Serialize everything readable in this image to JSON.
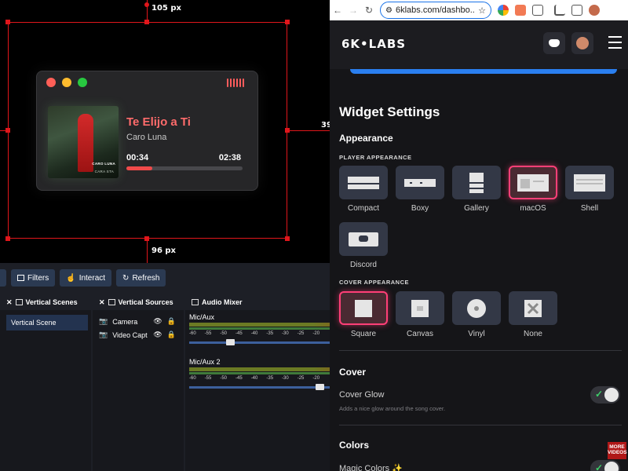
{
  "preview": {
    "dist_top": "105 px",
    "dist_bottom": "96 px",
    "dist_right": "39",
    "player": {
      "song_title": "Te Elijo a Ti",
      "artist": "Caro Luna",
      "current_time": "00:34",
      "total_time": "02:38",
      "progress_pct": 22,
      "cover_text_top": "CARO LUNA",
      "cover_text_bottom": "CARA STA"
    }
  },
  "obs": {
    "toolbar": {
      "filters": "Filters",
      "interact": "Interact",
      "refresh": "Refresh"
    },
    "scenes": {
      "title": "Vertical Scenes",
      "items": [
        "Vertical Scene"
      ]
    },
    "sources": {
      "title": "Vertical Sources",
      "items": [
        "Camera",
        "Video Capt"
      ]
    },
    "mixer": {
      "title": "Audio Mixer",
      "channels": [
        {
          "name": "Mic/Aux",
          "volume_pct": 28
        },
        {
          "name": "Mic/Aux 2",
          "volume_pct": 95
        }
      ],
      "scale": [
        "-60",
        "-55",
        "-50",
        "-45",
        "-40",
        "-35",
        "-30",
        "-25",
        "-20"
      ]
    }
  },
  "browser": {
    "url": "6klabs.com/dashbo...",
    "logo": "6K•LABS"
  },
  "settings": {
    "title": "Widget Settings",
    "appearance": "Appearance",
    "player_appearance": "PLAYER APPEARANCE",
    "player_options": [
      "Compact",
      "Boxy",
      "Gallery",
      "macOS",
      "Shell",
      "Discord"
    ],
    "cover_appearance": "COVER APPEARANCE",
    "cover_options": [
      "Square",
      "Canvas",
      "Vinyl",
      "None"
    ],
    "cover_section": "Cover",
    "cover_glow": "Cover Glow",
    "cover_glow_desc": "Adds a nice glow around the song cover.",
    "colors_section": "Colors",
    "magic_colors": "Magic Colors ✨",
    "more_videos": "MORE VIDEOS"
  }
}
